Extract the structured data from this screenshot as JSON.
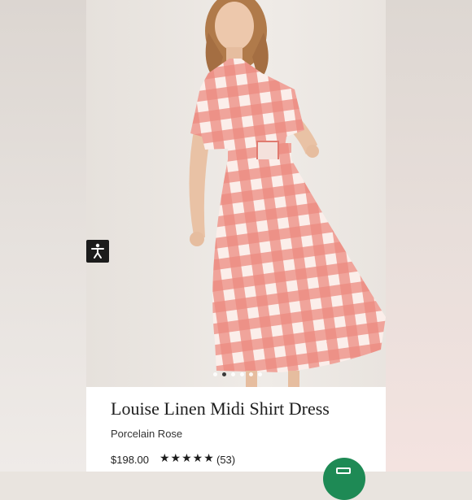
{
  "product": {
    "title": "Louise Linen Midi Shirt Dress",
    "color": "Porcelain Rose",
    "price": "$198.00",
    "rating": 4.5,
    "rating_stars": "★★★★★",
    "review_count": "(53)"
  },
  "carousel": {
    "slide_count": 6,
    "active_index": 1
  },
  "icons": {
    "accessibility": "accessibility-icon",
    "fab": "chat-icon"
  },
  "colors": {
    "gingham": "#e8685d",
    "accent_button": "#1e8a55",
    "dark_badge": "#1c1c1c"
  }
}
